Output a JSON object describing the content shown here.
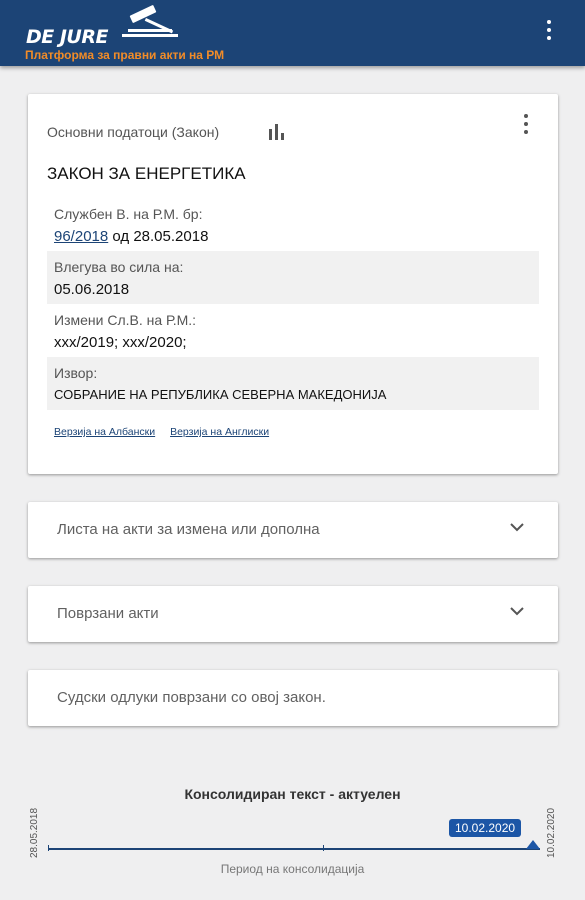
{
  "app": {
    "logo_text": "DE JURE",
    "subtitle": "Платформа за правни акти на РМ"
  },
  "basic_data": {
    "header": "Основни податоци (Закон)",
    "law_title": "ЗАКОН ЗА ЕНЕРГЕТИКА",
    "gazette_label": "Службен В. на Р.М. бр:",
    "gazette_number": "96/2018",
    "gazette_date_text": " од 28.05.2018",
    "effective_label": "Влегува во сила на:",
    "effective_value": "05.06.2018",
    "amended_label": "Измени Сл.В. на Р.М.:",
    "amended_value": "xxx/2019;  xxx/2020;",
    "source_label": "Извор:",
    "source_value": "СОБРАНИЕ НА РЕПУБЛИКА СЕВЕРНА МАКЕДОНИЈА",
    "version_albanian": "Верзија на Албански",
    "version_english": "Верзија на Англиски"
  },
  "sections": [
    {
      "label": "Листа на акти за измена или дополна",
      "has_chevron": true
    },
    {
      "label": "Поврзани акти",
      "has_chevron": true
    },
    {
      "label": "Судски одлуки поврзани со овој закон.",
      "has_chevron": false
    }
  ],
  "timeline": {
    "title": "Консолидиран текст - актуелен",
    "start_date": "28.05.2018",
    "end_date": "10.02.2020",
    "selected_date": "10.02.2020",
    "selected_position": 1.0,
    "caption": "Период на консолидација"
  },
  "colors": {
    "appbar": "#1c4476",
    "subtitle": "#f28c28",
    "accent": "#1c56a6",
    "background": "#efeff0"
  }
}
